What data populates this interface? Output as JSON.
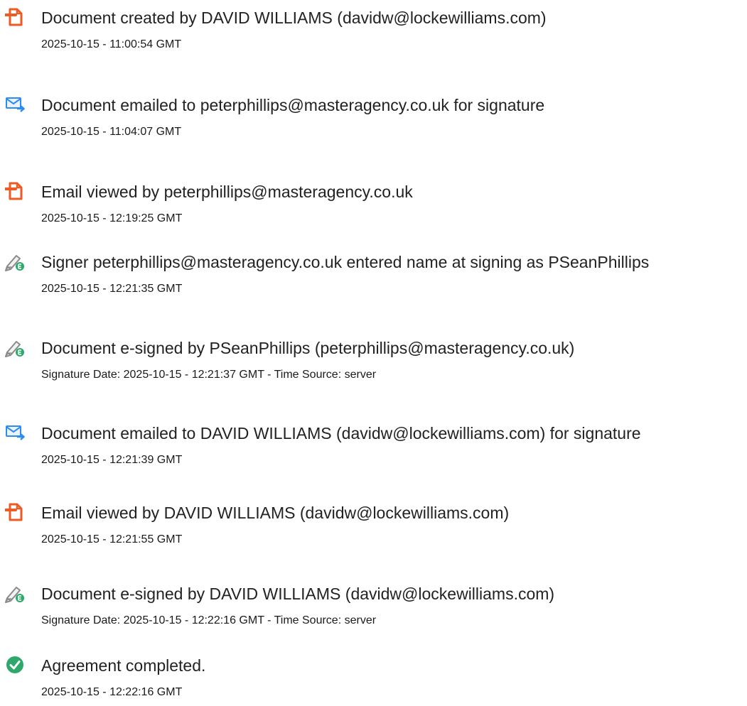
{
  "events": [
    {
      "icon": "document-created-icon",
      "title": "Document created by DAVID WILLIAMS (davidw@lockewilliams.com)",
      "time": "2025-10-15 - 11:00:54 GMT"
    },
    {
      "icon": "email-sent-icon",
      "title": "Document emailed to peterphillips@masteragency.co.uk for signature",
      "time": "2025-10-15 - 11:04:07 GMT"
    },
    {
      "icon": "document-viewed-icon",
      "title": "Email viewed by peterphillips@masteragency.co.uk",
      "time": "2025-10-15 - 12:19:25 GMT"
    },
    {
      "icon": "esign-pen-icon",
      "title": "Signer peterphillips@masteragency.co.uk entered name at signing as PSeanPhillips",
      "time": "2025-10-15 - 12:21:35 GMT"
    },
    {
      "icon": "esign-pen-icon",
      "title": "Document e-signed by PSeanPhillips (peterphillips@masteragency.co.uk)",
      "time": "Signature Date: 2025-10-15 - 12:21:37 GMT - Time Source: server"
    },
    {
      "icon": "email-sent-icon",
      "title": "Document emailed to DAVID WILLIAMS (davidw@lockewilliams.com) for signature",
      "time": "2025-10-15 - 12:21:39 GMT"
    },
    {
      "icon": "document-viewed-icon",
      "title": "Email viewed by DAVID WILLIAMS (davidw@lockewilliams.com)",
      "time": "2025-10-15 - 12:21:55 GMT"
    },
    {
      "icon": "esign-pen-icon",
      "title": "Document e-signed by DAVID WILLIAMS (davidw@lockewilliams.com)",
      "time": "Signature Date: 2025-10-15 - 12:22:16 GMT - Time Source: server"
    },
    {
      "icon": "completed-check-icon",
      "title": "Agreement completed.",
      "time": "2025-10-15 - 12:22:16 GMT"
    }
  ],
  "colors": {
    "document_icon": "#ed5a24",
    "email_icon": "#2d8cf0",
    "pen_icon": "#8a8a8a",
    "esign_badge": "#2ea86b",
    "completed_icon": "#2ea86b"
  }
}
